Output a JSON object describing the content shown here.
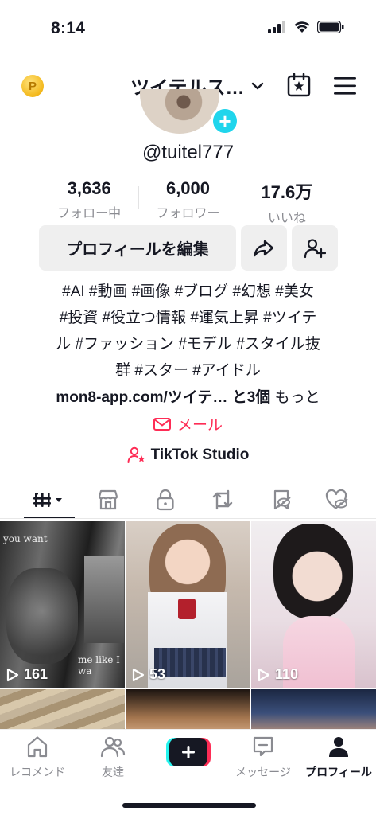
{
  "status": {
    "time": "8:14"
  },
  "header": {
    "username": "ツイテルス…",
    "coin_letter": "P"
  },
  "profile": {
    "handle": "@tuitel777",
    "stats": [
      {
        "value": "3,636",
        "label": "フォロー中"
      },
      {
        "value": "6,000",
        "label": "フォロワー"
      },
      {
        "value": "17.6万",
        "label": "いいね"
      }
    ],
    "edit_label": "プロフィールを編集",
    "bio_lines": [
      "#AI #動画 #画像 #ブログ #幻想 #美女",
      "#投資 #役立つ情報 #運気上昇 #ツイテ",
      "ル #ファッション #モデル #スタイル抜",
      "群 #スター #アイドル"
    ],
    "link_text": "mon8-app.com/ツイテ…",
    "link_extra": "と3個",
    "link_more": "もっと",
    "mail_label": "メール",
    "studio_label": "TikTok Studio"
  },
  "videos": [
    {
      "views": "161",
      "overlay_top": "you want",
      "overlay_bottom": "me like I wa"
    },
    {
      "views": "53"
    },
    {
      "views": "110"
    }
  ],
  "nav": {
    "home": "レコメンド",
    "friends": "友達",
    "messages": "メッセージ",
    "profile": "プロフィール"
  },
  "colors": {
    "accent": "#fe2c55",
    "cyan": "#20d5ec"
  }
}
